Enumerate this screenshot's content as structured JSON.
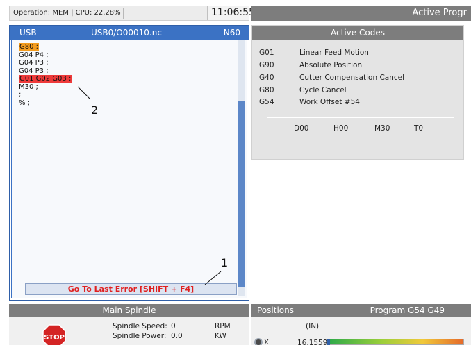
{
  "status_bar": {
    "text": "Operation: MEM | CPU: 22.28%",
    "clock": "11:06:55"
  },
  "active_program_bar": {
    "title": "Active Progr"
  },
  "program_pane": {
    "device": "USB",
    "file": "USB0/O00010.nc",
    "block": "N60",
    "lines": [
      {
        "text": "G80 ;",
        "highlight": "orange"
      },
      {
        "text": "G04 P4 ;",
        "highlight": ""
      },
      {
        "text": "G04 P3 ;",
        "highlight": ""
      },
      {
        "text": "G04 P3 ;",
        "highlight": ""
      },
      {
        "text": "G01 G02 G03 ;",
        "highlight": "red"
      },
      {
        "text": "M30 ;",
        "highlight": ""
      },
      {
        "text": ";",
        "highlight": ""
      },
      {
        "text": "% ;",
        "highlight": ""
      }
    ],
    "goto_error_label": "Go To Last Error [SHIFT + F4]"
  },
  "callouts": {
    "one": "1",
    "two": "2"
  },
  "active_codes": {
    "title": "Active Codes",
    "rows": [
      {
        "code": "G01",
        "desc": "Linear Feed Motion"
      },
      {
        "code": "G90",
        "desc": "Absolute Position"
      },
      {
        "code": "G40",
        "desc": "Cutter Compensation Cancel"
      },
      {
        "code": "G80",
        "desc": "Cycle Cancel"
      },
      {
        "code": "G54",
        "desc": "Work Offset #54"
      }
    ],
    "tools": [
      "D00",
      "H00",
      "M30",
      "T0"
    ]
  },
  "main_spindle": {
    "title": "Main Spindle",
    "stop_label": "STOP",
    "speed_label": "Spindle Speed:",
    "speed_value": "0",
    "speed_unit": "RPM",
    "power_label": "Spindle Power:",
    "power_value": "0.0",
    "power_unit": "KW"
  },
  "positions": {
    "title": "Positions",
    "program": "Program G54 G49",
    "units": "(IN)",
    "axis_label": "X",
    "axis_value": "16.1559"
  },
  "colors": {
    "header_blue": "#3b72c4",
    "header_grey": "#7d7d7d",
    "highlight_orange": "#f49c1f",
    "highlight_red": "#ee3a3a",
    "error_text": "#e02020"
  }
}
